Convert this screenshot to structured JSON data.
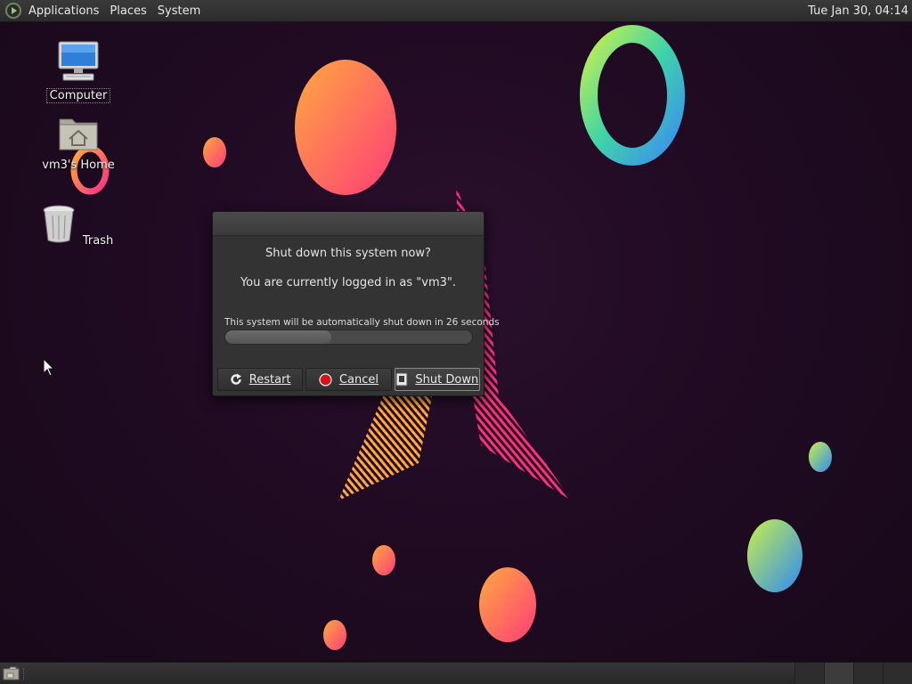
{
  "top_panel": {
    "menus": [
      "Applications",
      "Places",
      "System"
    ],
    "clock": "Tue Jan 30, 04:14"
  },
  "desktop_icons": [
    {
      "label": "Computer",
      "icon": "computer-icon"
    },
    {
      "label": "vm3's Home",
      "icon": "home-folder-icon"
    },
    {
      "label": "Trash",
      "icon": "trash-icon"
    }
  ],
  "dialog": {
    "question": "Shut down this system now?",
    "user_message": "You are currently logged in as \"vm3\".",
    "countdown": "This system will be automatically shut down in 26 seconds",
    "progress_fraction": 0.43,
    "buttons": {
      "restart": "Restart",
      "cancel": "Cancel",
      "shutdown": "Shut Down"
    }
  },
  "bottom_panel": {
    "workspaces": 4,
    "active_workspace": 1
  },
  "colors": {
    "panel": "#2b2b2b",
    "desktop_bg": "#1e0a21",
    "cancel_red": "#d4141c"
  }
}
